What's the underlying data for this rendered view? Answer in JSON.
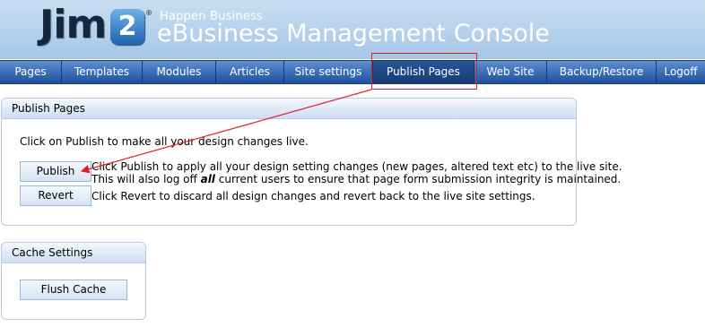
{
  "header": {
    "logo_text": "Jim",
    "logo_number": "2",
    "logo_mark": "®",
    "tagline": "Happen Business",
    "title": "eBusiness Management Console"
  },
  "nav": {
    "items": [
      {
        "label": "Pages"
      },
      {
        "label": "Templates"
      },
      {
        "label": "Modules"
      },
      {
        "label": "Articles"
      },
      {
        "label": "Site settings"
      },
      {
        "label": "Publish Pages",
        "active": true
      },
      {
        "label": "Web Site"
      },
      {
        "label": "Backup/Restore"
      },
      {
        "label": "Logoff"
      }
    ]
  },
  "publish_panel": {
    "title": "Publish Pages",
    "intro": "Click on Publish to make all your design changes live.",
    "publish_button": "Publish",
    "publish_desc_line1": "Click Publish to apply all your design setting changes (new pages, altered text etc) to the live site.",
    "publish_desc_line2_pre": "This will also log off ",
    "publish_desc_line2_em": "all",
    "publish_desc_line2_post": " current users to ensure that page form submission integrity is maintained.",
    "revert_button": "Revert",
    "revert_desc": "Click Revert to discard all design changes and revert back to the live site settings."
  },
  "cache_panel": {
    "title": "Cache Settings",
    "flush_button": "Flush Cache"
  },
  "colors": {
    "annotation": "#e02020",
    "nav_bg": "#2b5ca6",
    "header_bg": "#b3cfea"
  }
}
